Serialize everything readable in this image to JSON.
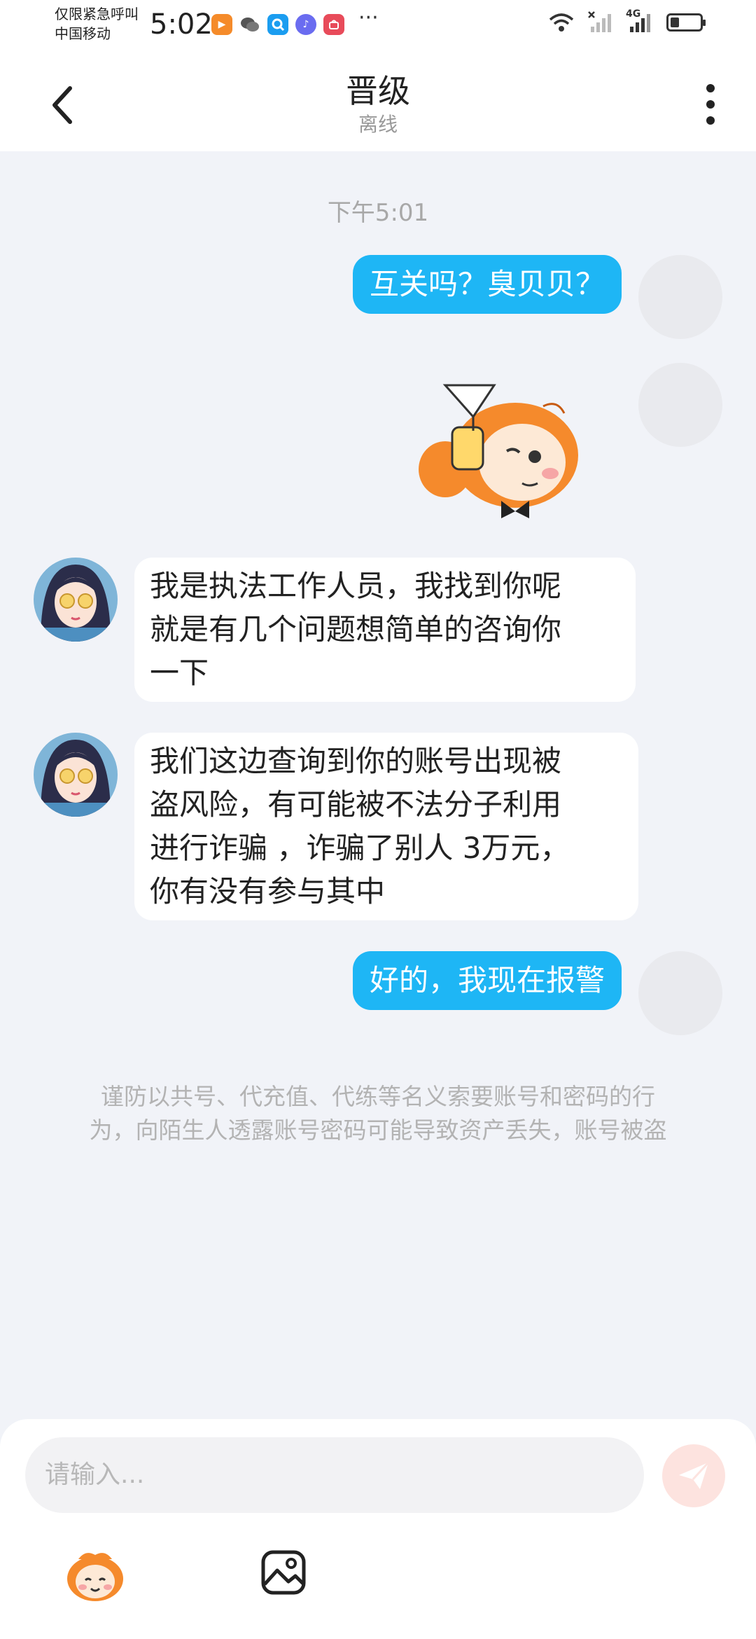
{
  "status_bar": {
    "carrier_line1": "仅限紧急呼叫",
    "carrier_line2": "中国移动",
    "time": "5:02",
    "more_indicator": "···",
    "network": "4G",
    "icons": [
      "video-app-icon",
      "wechat-icon",
      "browser-icon",
      "music-icon",
      "huawei-store-icon",
      "wifi-icon",
      "signal-icon",
      "battery-icon"
    ]
  },
  "header": {
    "title": "晋级",
    "subtitle": "离线",
    "back_icon": "chevron-left-icon",
    "more_icon": "more-vertical-icon"
  },
  "chat": {
    "timestamp": "下午5:01",
    "messages": [
      {
        "direction": "out",
        "type": "text",
        "text": "互关吗？臭贝贝？"
      },
      {
        "direction": "out",
        "type": "sticker",
        "text": ""
      },
      {
        "direction": "in",
        "type": "text",
        "lines": [
          "我是执法工作人员，我找到你呢",
          "就是有几个问题想简单的咨询你",
          "一下"
        ]
      },
      {
        "direction": "in",
        "type": "text",
        "lines": [
          "我们这边查询到你的账号出现被",
          "盗风险，有可能被不法分子利用",
          "进行诈骗 ，诈骗了别人 3万元，",
          "你有没有参与其中"
        ]
      },
      {
        "direction": "out",
        "type": "text",
        "text": "好的，我现在报警"
      }
    ],
    "notice_lines": [
      "谨防以共号、代充值、代练等名义索要账号和密码的行",
      "为，向陌生人透露账号密码可能导致资产丢失，账号被盗"
    ]
  },
  "composer": {
    "placeholder": "请输入...",
    "send_icon": "send-icon",
    "tools": [
      "mascot-emoji-icon",
      "image-icon"
    ]
  },
  "colors": {
    "outgoing_bubble": "#1eb6f5",
    "incoming_bubble": "#ffffff",
    "chat_background": "#f1f3f8",
    "send_button": "#fde3df"
  }
}
